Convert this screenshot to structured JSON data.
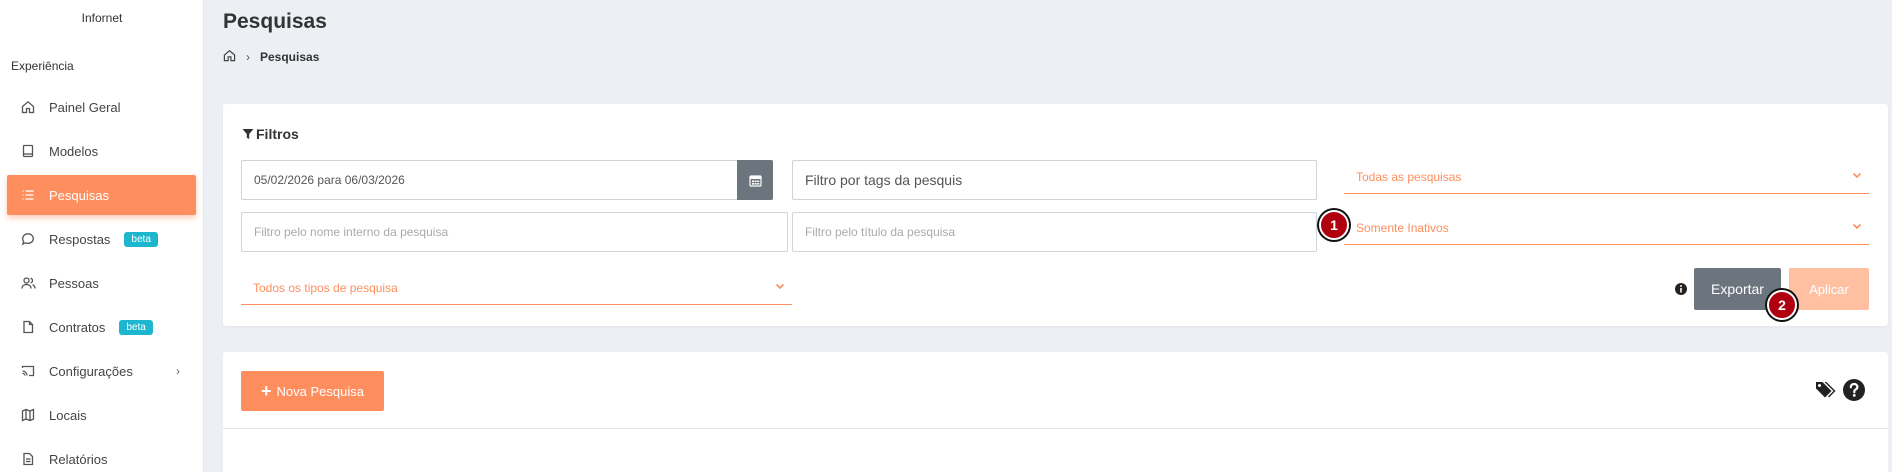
{
  "sidebar": {
    "brand": "Infornet",
    "section": "Experiência",
    "items": [
      {
        "label": "Painel Geral",
        "icon": "home-icon"
      },
      {
        "label": "Modelos",
        "icon": "book-icon"
      },
      {
        "label": "Pesquisas",
        "icon": "list-icon",
        "active": true
      },
      {
        "label": "Respostas",
        "icon": "chat-icon",
        "badge": "beta"
      },
      {
        "label": "Pessoas",
        "icon": "users-icon"
      },
      {
        "label": "Contratos",
        "icon": "file-icon",
        "badge": "beta"
      },
      {
        "label": "Configurações",
        "icon": "cast-icon",
        "has_submenu": true
      },
      {
        "label": "Locais",
        "icon": "map-icon"
      },
      {
        "label": "Relatórios",
        "icon": "report-icon"
      }
    ]
  },
  "header": {
    "title": "Pesquisas",
    "breadcrumb": {
      "current": "Pesquisas"
    }
  },
  "filters": {
    "heading": "Filtros",
    "date_range": "05/02/2026 para 06/03/2026",
    "tags_placeholder": "Filtro por tags da pesquis",
    "survey_select": "Todas as pesquisas",
    "internal_name_placeholder": "Filtro pelo nome interno da pesquisa",
    "title_placeholder": "Filtro pelo título da pesquisa",
    "status_select": "Somente Inativos",
    "type_select": "Todos os tipos de pesquisa",
    "export_label": "Exportar",
    "apply_label": "Aplicar",
    "marker_1": "1",
    "marker_2": "2"
  },
  "list": {
    "new_button_label": "Nova Pesquisa"
  },
  "colors": {
    "accent": "#ff8e5e",
    "secondary": "#6c757d",
    "badge": "#1cb7cf",
    "marker": "#b00010"
  }
}
